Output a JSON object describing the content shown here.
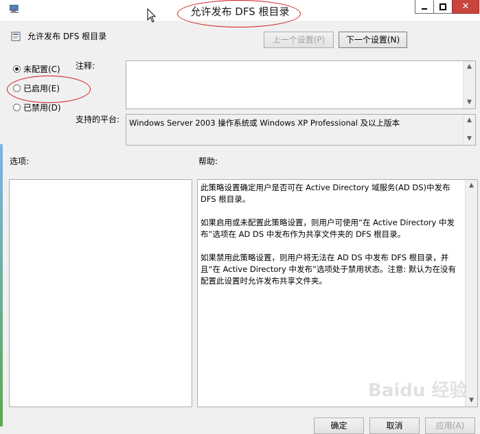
{
  "window": {
    "title": "允许发布 DFS 根目录",
    "close_glyph": "✕"
  },
  "policy": {
    "name": "允许发布 DFS 根目录"
  },
  "nav": {
    "prev_label": "上一个设置(P)",
    "next_label": "下一个设置(N)"
  },
  "config": {
    "options": [
      {
        "label": "未配置(C)",
        "checked": true
      },
      {
        "label": "已启用(E)",
        "checked": false
      },
      {
        "label": "已禁用(D)",
        "checked": false
      }
    ]
  },
  "comment": {
    "label": "注释:",
    "value": ""
  },
  "platform": {
    "label": "支持的平台:",
    "value": "Windows Server 2003 操作系统或 Windows XP Professional 及以上版本"
  },
  "sections": {
    "options_label": "选项:",
    "help_label": "帮助:"
  },
  "help": {
    "paragraphs": [
      "此策略设置确定用户是否可在 Active Directory 域服务(AD DS)中发布 DFS 根目录。",
      "如果启用或未配置此策略设置，则用户可使用“在 Active Directory 中发布”选项在 AD DS 中发布作为共享文件夹的 DFS 根目录。",
      "如果禁用此策略设置，则用户将无法在 AD DS 中发布 DFS 根目录，并且“在 Active Directory 中发布”选项处于禁用状态。注意: 默认为在没有配置此设置时允许发布共享文件夹。"
    ]
  },
  "footer": {
    "ok_label": "确定",
    "cancel_label": "取消",
    "apply_label": "应用(A)"
  },
  "watermark": "Baidu 经验",
  "colors": {
    "annotation": "#d01818",
    "close_button": "#c7453c"
  }
}
